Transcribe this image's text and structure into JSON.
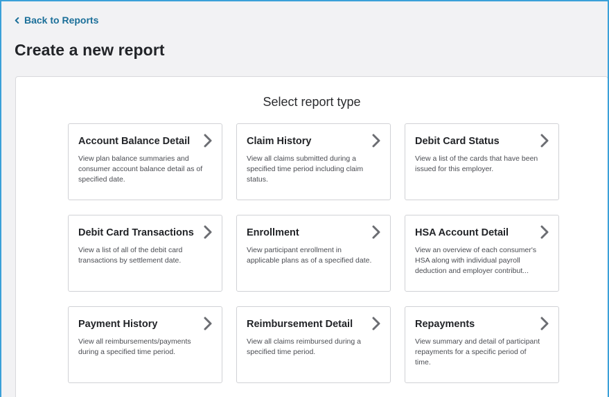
{
  "nav": {
    "back_label": "Back to Reports",
    "back_icon": "chevron-left-icon"
  },
  "header": {
    "title": "Create a new report"
  },
  "main": {
    "heading": "Select report type",
    "cards": [
      {
        "title": "Account Balance Detail",
        "description": "View plan balance summaries and consumer account balance detail as of specified date."
      },
      {
        "title": "Claim History",
        "description": "View all claims submitted during a specified time period including claim status."
      },
      {
        "title": "Debit Card Status",
        "description": "View a list of the cards that have been issued for this employer."
      },
      {
        "title": "Debit Card Transactions",
        "description": "View a list of all of the debit card transactions by settlement date."
      },
      {
        "title": "Enrollment",
        "description": "View participant enrollment in applicable plans as of a specified date."
      },
      {
        "title": "HSA Account Detail",
        "description": "View an overview of each consumer's HSA along with individual payroll deduction and employer contribut..."
      },
      {
        "title": "Payment History",
        "description": "View all reimbursements/payments during a specified time period."
      },
      {
        "title": "Reimbursement Detail",
        "description": "View all claims reimbursed during a specified time period."
      },
      {
        "title": "Repayments",
        "description": "View summary and detail of participant repayments for a specific period of time."
      }
    ],
    "card_icon": "chevron-right-icon"
  },
  "colors": {
    "accent_border": "#3aa0d8",
    "link": "#1b6f99",
    "page_bg": "#f2f2f4",
    "panel_bg": "#ffffff",
    "arrow": "#6b6d72"
  }
}
